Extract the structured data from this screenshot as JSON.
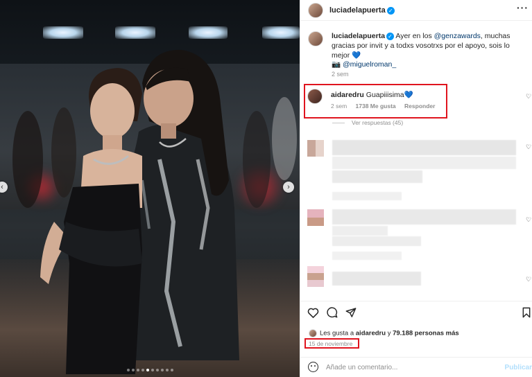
{
  "post": {
    "username": "luciadelapuerta",
    "more_label": "···",
    "caption_text": "Ayer en los @genzawards, muchas gracias por invit y a todxs vosotrxs por el apoyo, sois lo mejor 💙",
    "caption_mention": "@genzawards",
    "credit_icon": "📷",
    "credit_mention": "@miguelroman_",
    "caption_time": "2 sem"
  },
  "highlighted_comment": {
    "username": "aidaredru",
    "text": "Guapiiisima💙",
    "time": "2 sem",
    "likes": "1738 Me gusta",
    "reply": "Responder"
  },
  "view_replies": "Ver respuestas (45)",
  "likes_line": {
    "prefix": "Les gusta a ",
    "user": "aidaredru",
    "middle": " y ",
    "count": "79.188 personas más"
  },
  "date": "15 de noviembre",
  "add_comment": {
    "placeholder": "Añade un comentario...",
    "publish": "Publicar"
  },
  "carousel": {
    "total_slides": 10,
    "active_slide": 1
  },
  "colors": {
    "highlight": "#e0141e",
    "verified": "#0095f6",
    "link": "#00376b"
  },
  "icons": [
    "heart-icon",
    "comment-icon",
    "share-icon",
    "bookmark-icon",
    "emoji-icon",
    "camera-icon",
    "verified-icon"
  ]
}
